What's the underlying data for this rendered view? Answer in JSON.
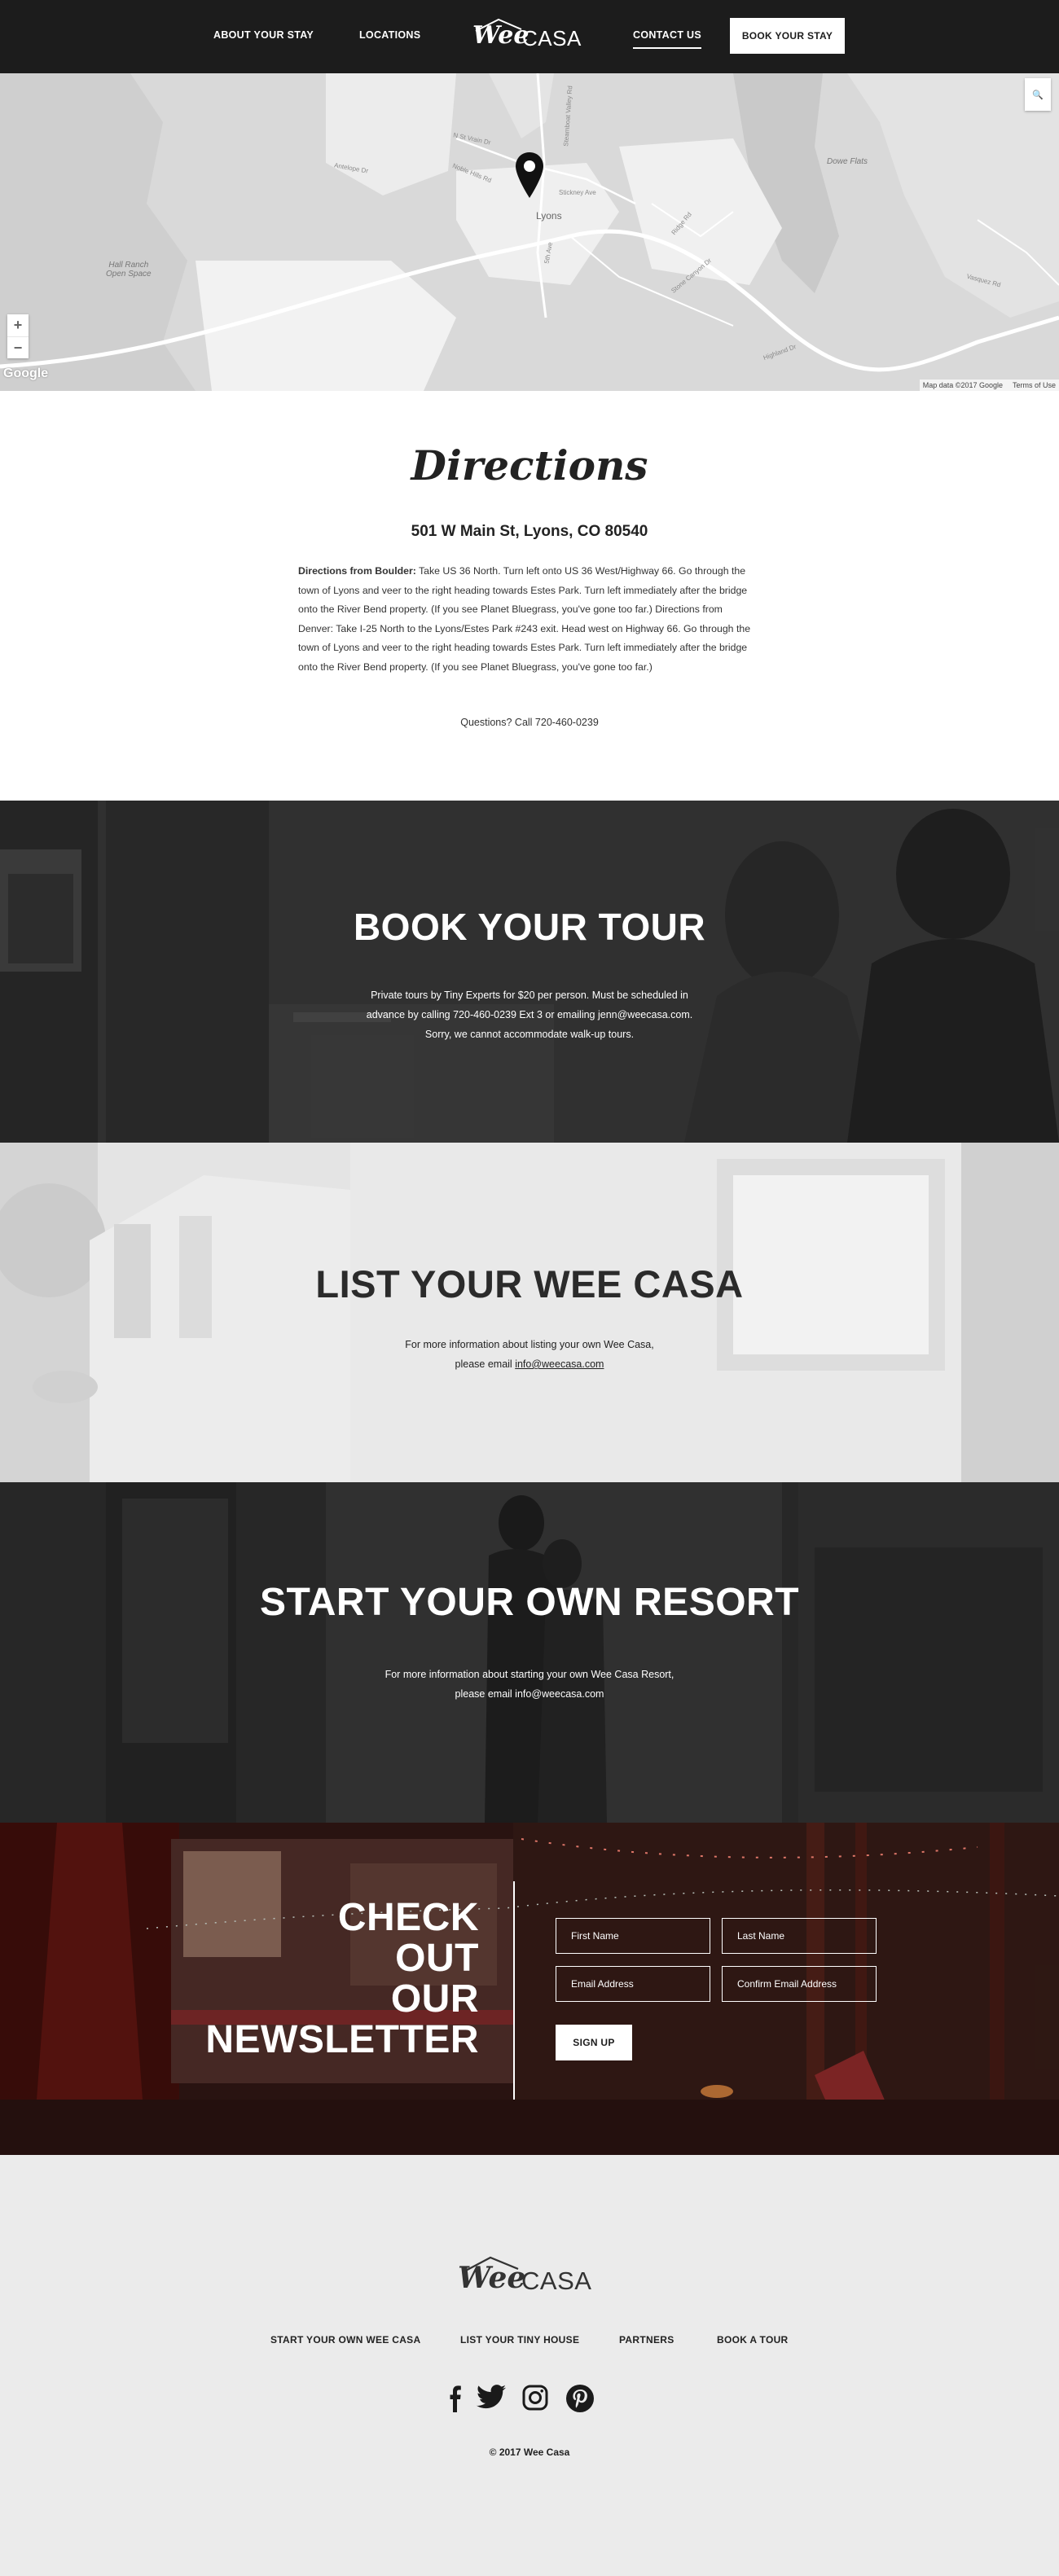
{
  "header": {
    "nav": [
      "ABOUT YOUR STAY",
      "LOCATIONS",
      "CONTACT US"
    ],
    "book_button": "BOOK YOUR STAY",
    "logo": {
      "wee": "Wee",
      "casa": "CASA"
    }
  },
  "map": {
    "labels": {
      "hall_ranch": "Hall Ranch\nOpen Space",
      "lyons": "Lyons",
      "dowe_flats": "Dowe Flats",
      "st_vrain": "N St Vrain Dr",
      "noble_hills": "Noble Hills Rd",
      "antelope": "Antelope Dr",
      "stickney": "Stickney Ave",
      "fifth_ave": "5th Ave",
      "ridge": "Ridge Rd",
      "stone_canyon": "Stone Canyon Dr",
      "vasquez": "Vasquez Rd",
      "highland": "Highland Dr",
      "steamboat": "Steamboat Valley Rd"
    },
    "zoom_in": "+",
    "zoom_out": "−",
    "search_icon": "🔍",
    "google": "Google",
    "map_data": "Map data ©2017 Google",
    "terms": "Terms of Use"
  },
  "directions": {
    "title": "Directions",
    "address": "501 W Main St, Lyons, CO 80540",
    "boulder_label": "Directions from Boulder:",
    "boulder_text": " Take US 36 North.  Turn left onto US 36 West/Highway 66.  Go through the town of Lyons and veer to the right heading towards Estes Park.  Turn left immediately after the bridge onto the River Bend property. (If you see Planet Bluegrass, you've gone too far.)",
    "denver_text": "Directions from Denver: Take I-25 North to the Lyons/Estes Park #243 exit. Head west on Highway 66. Go through the town of Lyons and veer to the right heading towards Estes Park. Turn left immediately after the bridge onto the River Bend property. (If you see Planet Bluegrass, you've gone too far.)",
    "question": "Questions? Call 720-460-0239"
  },
  "tour": {
    "title": "BOOK YOUR TOUR",
    "line1": "Private tours by Tiny Experts for $20 per person. Must be scheduled in",
    "line2": "advance by calling 720-460-0239 Ext 3 or emailing jenn@weecasa.com.",
    "line3": "Sorry, we cannot accommodate walk-up tours."
  },
  "list": {
    "title": "LIST YOUR WEE CASA",
    "line1": "For more information about listing your own Wee Casa,",
    "line2_prefix": "please email ",
    "email": "info@weecasa.com"
  },
  "resort": {
    "title": "START YOUR OWN RESORT",
    "line1": "For more information about starting your own Wee Casa Resort,",
    "line2": "please email info@weecasa.com"
  },
  "newsletter": {
    "title_lines": [
      "CHECK",
      "OUT",
      "OUR",
      "NEWSLETTER"
    ],
    "first_name": "First Name",
    "last_name": "Last Name",
    "email": "Email Address",
    "confirm_email": "Confirm Email Address",
    "signup": "SIGN UP"
  },
  "footer": {
    "logo": {
      "wee": "Wee",
      "casa": "CASA"
    },
    "links": [
      "START YOUR OWN WEE CASA",
      "LIST YOUR TINY HOUSE",
      "PARTNERS",
      "BOOK A TOUR"
    ],
    "social_icons": [
      "facebook-icon",
      "twitter-icon",
      "instagram-icon",
      "pinterest-icon"
    ],
    "copyright": "© 2017 Wee Casa"
  },
  "colors": {
    "header_bg": "#1c1c1c",
    "footer_bg": "#ebebeb",
    "text_dark": "#222222"
  }
}
